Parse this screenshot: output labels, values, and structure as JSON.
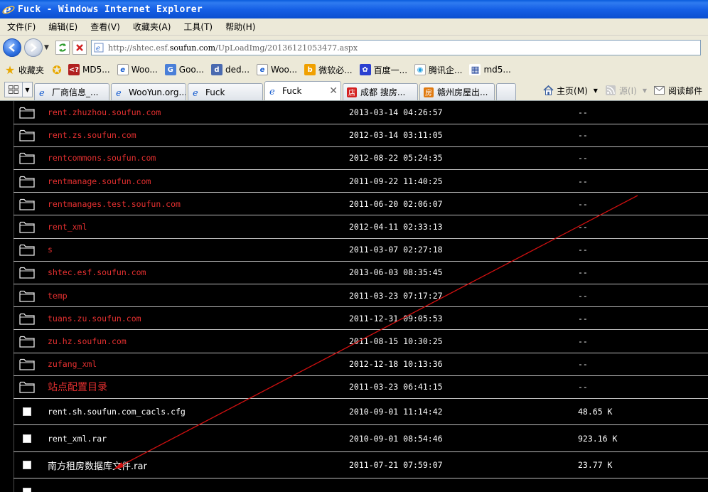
{
  "window": {
    "title": "Fuck - Windows Internet Explorer"
  },
  "menu": {
    "items": [
      "文件(F)",
      "编辑(E)",
      "查看(V)",
      "收藏夹(A)",
      "工具(T)",
      "帮助(H)"
    ]
  },
  "address": {
    "url_prefix": "http://shtec.esf.",
    "url_domain": "soufun.com",
    "url_path": "/UpLoadImg/20136121053477.aspx"
  },
  "favorites": {
    "label": "收藏夹",
    "items": [
      {
        "label": "MD5...",
        "icon": "md5-site-icon"
      },
      {
        "label": "Woo...",
        "icon": "ie-page-icon"
      },
      {
        "label": "Goo...",
        "icon": "google-translate-icon"
      },
      {
        "label": "ded...",
        "icon": "dedecms-icon"
      },
      {
        "label": "Woo...",
        "icon": "ie-page-icon"
      },
      {
        "label": "微软必...",
        "icon": "bing-icon"
      },
      {
        "label": "百度一...",
        "icon": "baidu-paw-icon"
      },
      {
        "label": "腾讯企...",
        "icon": "tencent-icon"
      },
      {
        "label": "md5...",
        "icon": "grid-icon"
      }
    ]
  },
  "tabs": {
    "items": [
      {
        "label": "厂商信息_...",
        "active": false
      },
      {
        "label": "WooYun.org...",
        "active": false
      },
      {
        "label": "Fuck",
        "active": false
      },
      {
        "label": "Fuck",
        "active": true
      },
      {
        "label": "成都 搜房...",
        "active": false
      },
      {
        "label": "赣州房屋出...",
        "active": false
      }
    ],
    "home_label": "主页(M)",
    "feeds_label": "源(I)",
    "read_mail_label": "阅读邮件"
  },
  "listing": {
    "directories": [
      {
        "name": "rent.zhuzhou.soufun.com",
        "date": "2013-03-14 04:26:57",
        "size": "--"
      },
      {
        "name": "rent.zs.soufun.com",
        "date": "2012-03-14 03:11:05",
        "size": "--"
      },
      {
        "name": "rentcommons.soufun.com",
        "date": "2012-08-22 05:24:35",
        "size": "--"
      },
      {
        "name": "rentmanage.soufun.com",
        "date": "2011-09-22 11:40:25",
        "size": "--"
      },
      {
        "name": "rentmanages.test.soufun.com",
        "date": "2011-06-20 02:06:07",
        "size": "--"
      },
      {
        "name": "rent_xml",
        "date": "2012-04-11 02:33:13",
        "size": "--"
      },
      {
        "name": "s",
        "date": "2011-03-07 02:27:18",
        "size": "--"
      },
      {
        "name": "shtec.esf.soufun.com",
        "date": "2013-06-03 08:35:45",
        "size": "--"
      },
      {
        "name": "temp",
        "date": "2011-03-23 07:17:27",
        "size": "--"
      },
      {
        "name": "tuans.zu.soufun.com",
        "date": "2011-12-31 09:05:53",
        "size": "--"
      },
      {
        "name": "zu.hz.soufun.com",
        "date": "2011-08-15 10:30:25",
        "size": "--"
      },
      {
        "name": "zufang_xml",
        "date": "2012-12-18 10:13:36",
        "size": "--"
      },
      {
        "name": "站点配置目录",
        "date": "2011-03-23 06:41:15",
        "size": "--"
      }
    ],
    "files": [
      {
        "name": "rent.sh.soufun.com_cacls.cfg",
        "date": "2010-09-01 11:14:42",
        "size": "48.65 K"
      },
      {
        "name": "rent_xml.rar",
        "date": "2010-09-01 08:54:46",
        "size": "923.16 K"
      },
      {
        "name": "南方租房数据库文件.rar",
        "date": "2011-07-21 07:59:07",
        "size": "23.77 K"
      }
    ]
  },
  "colors": {
    "directory_link": "#e53030",
    "file_text": "#ffffff",
    "background": "#000000",
    "annotation_arrow": "#d01010"
  }
}
